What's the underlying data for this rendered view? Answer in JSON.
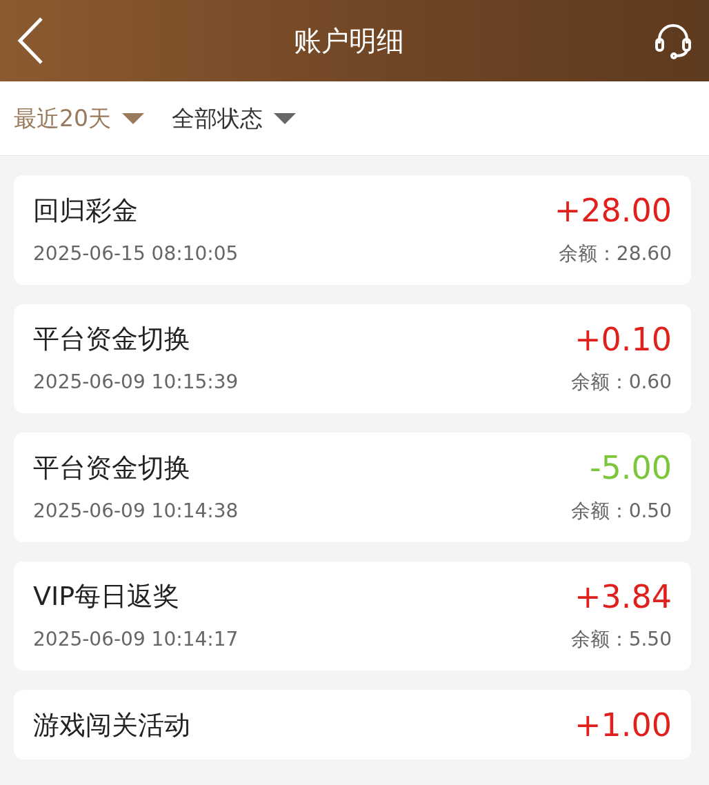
{
  "header": {
    "title": "账户明细"
  },
  "filters": [
    {
      "label": "最近20天",
      "selected": true
    },
    {
      "label": "全部状态",
      "selected": false
    }
  ],
  "transactions": [
    {
      "title": "回归彩金",
      "amount": "+28.00",
      "kind": "credit",
      "time": "2025-06-15 08:10:05",
      "balance": "余额：28.60"
    },
    {
      "title": "平台资金切换",
      "amount": "+0.10",
      "kind": "credit",
      "time": "2025-06-09 10:15:39",
      "balance": "余额：0.60"
    },
    {
      "title": "平台资金切换",
      "amount": "-5.00",
      "kind": "debit",
      "time": "2025-06-09 10:14:38",
      "balance": "余额：0.50"
    },
    {
      "title": "VIP每日返奖",
      "amount": "+3.84",
      "kind": "credit",
      "time": "2025-06-09 10:14:17",
      "balance": "余额：5.50"
    },
    {
      "title": "游戏闯关活动",
      "amount": "+1.00",
      "kind": "credit"
    }
  ]
}
